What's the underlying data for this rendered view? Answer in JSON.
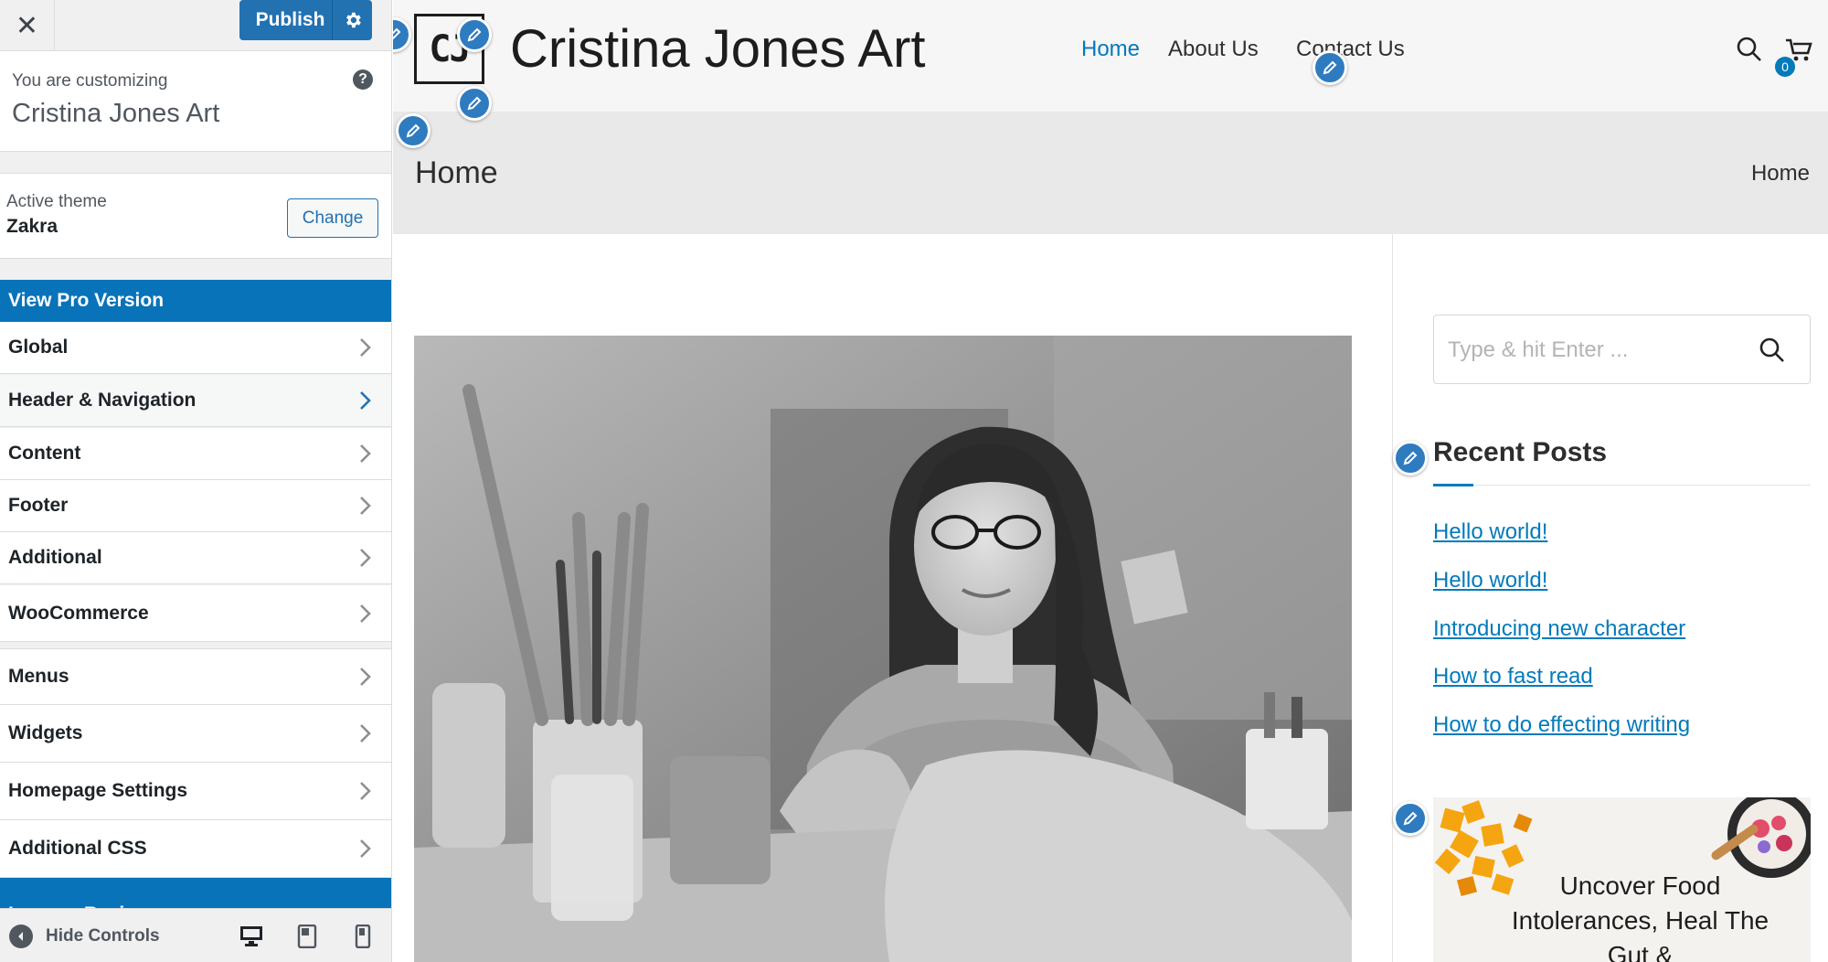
{
  "customizer": {
    "close_glyph": "✕",
    "publish_label": "Publish",
    "customizing_label": "You are customizing",
    "site_name": "Cristina Jones Art",
    "help_glyph": "?",
    "active_theme_label": "Active theme",
    "theme_name": "Zakra",
    "change_label": "Change",
    "pro_label": "View Pro Version",
    "panels": [
      {
        "label": "Global"
      },
      {
        "label": "Header & Navigation",
        "active": true
      },
      {
        "label": "Content"
      },
      {
        "label": "Footer"
      },
      {
        "label": "Additional"
      },
      {
        "label": "WooCommerce"
      },
      {
        "label": "Menus"
      },
      {
        "label": "Widgets"
      },
      {
        "label": "Homepage Settings"
      },
      {
        "label": "Additional CSS"
      }
    ],
    "review_label": "Leave a Review on .org",
    "hide_controls_label": "Hide Controls",
    "devices": [
      "desktop-icon",
      "tablet-icon",
      "mobile-icon"
    ],
    "accent_color": "#2271b1"
  },
  "site": {
    "logo_text": "CJ",
    "title": "Cristina Jones Art",
    "nav": [
      "Home",
      "About Us",
      "Contact Us"
    ],
    "cart_count": "0",
    "page_title": "Home",
    "breadcrumb": "Home",
    "link_color": "#027abb",
    "sidebar": {
      "search_placeholder": "Type & hit Enter ...",
      "recent_title": "Recent Posts",
      "posts": [
        "Hello world!",
        "Hello world!",
        "Introducing new character",
        "How to fast read",
        "How to do effecting writing"
      ],
      "ad_text": "Uncover Food Intolerances, Heal The Gut &"
    }
  }
}
